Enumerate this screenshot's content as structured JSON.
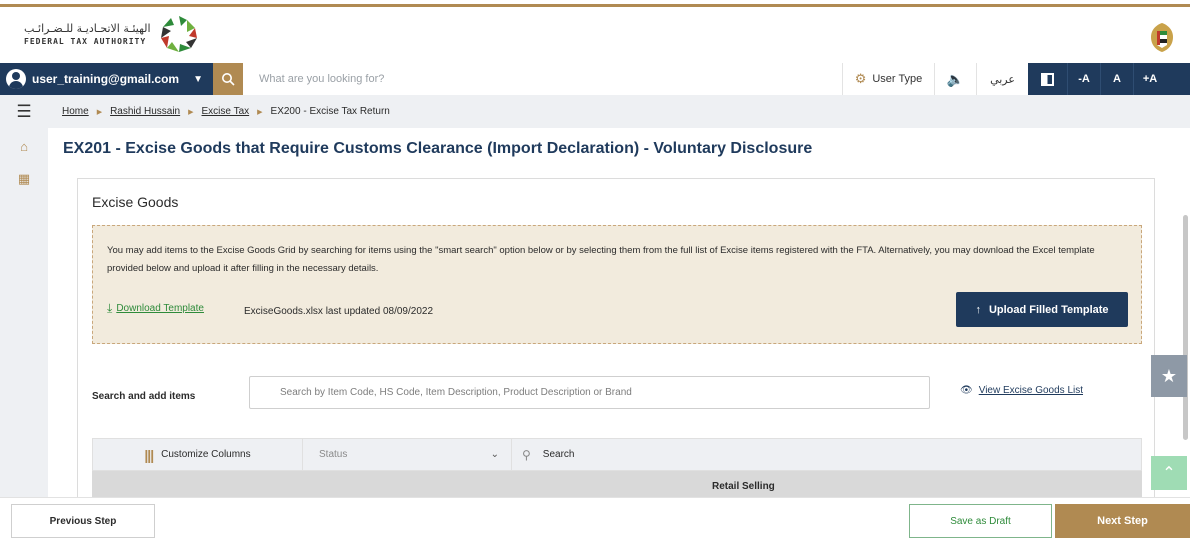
{
  "header": {
    "logo_ar": "الهيئـة الاتحـاديـة للـضـرائـب",
    "logo_en": "FEDERAL TAX AUTHORITY"
  },
  "toolbar": {
    "user_email": "user_training@gmail.com",
    "search_placeholder": "What are you looking for?",
    "user_type_label": "User Type",
    "language_label": "عربي",
    "font_decrease": "-A",
    "font_normal": "A",
    "font_increase": "+A"
  },
  "breadcrumb": {
    "items": [
      "Home",
      "Rashid Hussain",
      "Excise Tax"
    ],
    "current": "EX200 - Excise Tax Return"
  },
  "page": {
    "title": "EX201 - Excise Goods that Require Customs Clearance (Import Declaration) - Voluntary Disclosure"
  },
  "card": {
    "title": "Excise Goods",
    "info_text": "You may add items to the Excise Goods Grid by searching for items using the \"smart search\" option below or by selecting them from the full list of Excise items registered with the FTA. Alternatively, you may download the Excel template provided below and upload it after filling in the necessary details.",
    "download_label": "Download Template",
    "file_meta": "ExciseGoods.xlsx last updated 08/09/2022",
    "upload_label": "Upload Filled Template",
    "search_label": "Search and add items",
    "search_placeholder": "Search by Item Code, HS Code, Item Description, Product Description or Brand",
    "view_list_label": "View Excise Goods List",
    "grid": {
      "customize_label": "Customize Columns",
      "status_placeholder": "Status",
      "search_label": "Search",
      "column_headers": [
        "Retail Selling"
      ]
    }
  },
  "footer": {
    "prev_label": "Previous Step",
    "draft_label": "Save as Draft",
    "next_label": "Next Step"
  },
  "colors": {
    "navy": "#1f3a5c",
    "gold": "#b08a52",
    "green": "#2e8b3a",
    "info_bg": "#f2ebdd"
  }
}
